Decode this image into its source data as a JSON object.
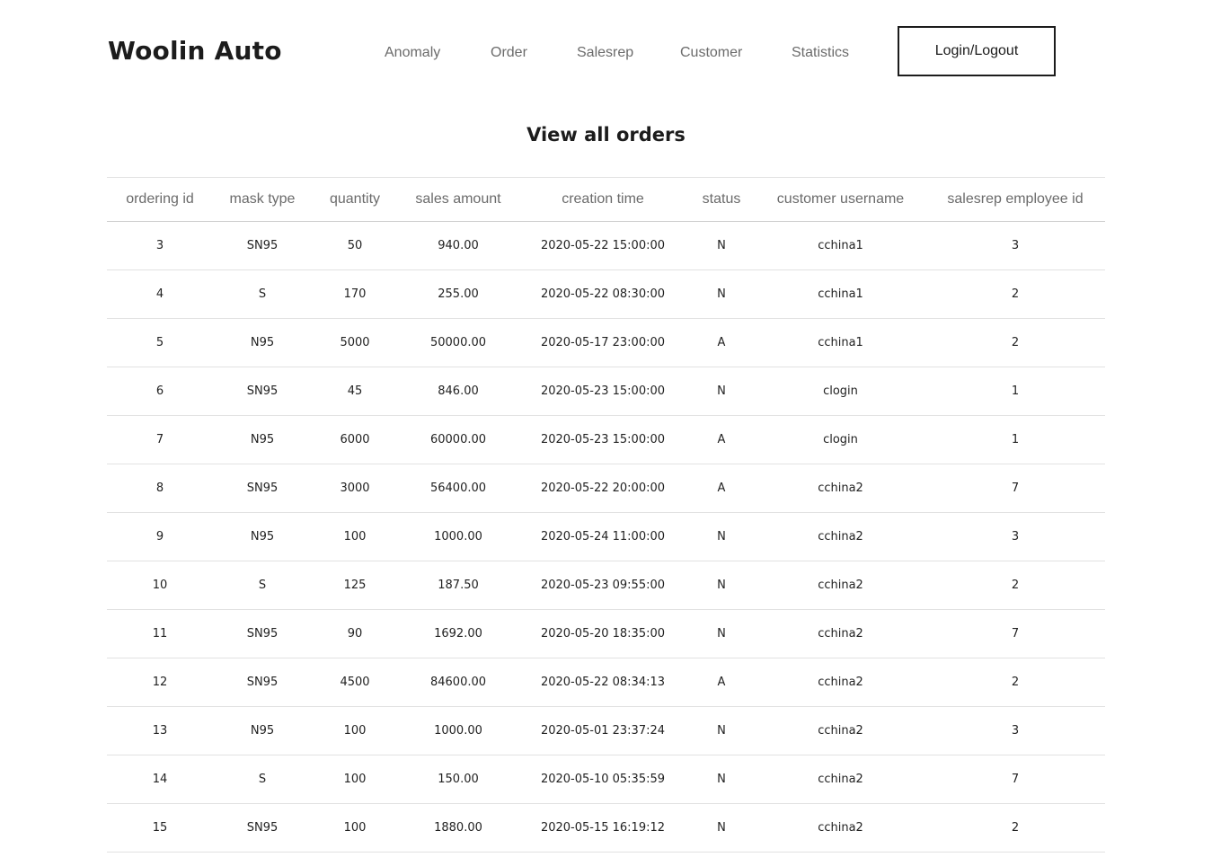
{
  "header": {
    "logo": "Woolin Auto",
    "nav": [
      {
        "label": "Anomaly"
      },
      {
        "label": "Order"
      },
      {
        "label": "Salesrep"
      },
      {
        "label": "Customer"
      },
      {
        "label": "Statistics"
      }
    ],
    "login_label": "Login/Logout"
  },
  "main": {
    "title": "View all orders",
    "columns": [
      "ordering id",
      "mask type",
      "quantity",
      "sales amount",
      "creation time",
      "status",
      "customer username",
      "salesrep employee id"
    ],
    "rows": [
      [
        "3",
        "SN95",
        "50",
        "940.00",
        "2020-05-22 15:00:00",
        "N",
        "cchina1",
        "3"
      ],
      [
        "4",
        "S",
        "170",
        "255.00",
        "2020-05-22 08:30:00",
        "N",
        "cchina1",
        "2"
      ],
      [
        "5",
        "N95",
        "5000",
        "50000.00",
        "2020-05-17 23:00:00",
        "A",
        "cchina1",
        "2"
      ],
      [
        "6",
        "SN95",
        "45",
        "846.00",
        "2020-05-23 15:00:00",
        "N",
        "clogin",
        "1"
      ],
      [
        "7",
        "N95",
        "6000",
        "60000.00",
        "2020-05-23 15:00:00",
        "A",
        "clogin",
        "1"
      ],
      [
        "8",
        "SN95",
        "3000",
        "56400.00",
        "2020-05-22 20:00:00",
        "A",
        "cchina2",
        "7"
      ],
      [
        "9",
        "N95",
        "100",
        "1000.00",
        "2020-05-24 11:00:00",
        "N",
        "cchina2",
        "3"
      ],
      [
        "10",
        "S",
        "125",
        "187.50",
        "2020-05-23 09:55:00",
        "N",
        "cchina2",
        "2"
      ],
      [
        "11",
        "SN95",
        "90",
        "1692.00",
        "2020-05-20 18:35:00",
        "N",
        "cchina2",
        "7"
      ],
      [
        "12",
        "SN95",
        "4500",
        "84600.00",
        "2020-05-22 08:34:13",
        "A",
        "cchina2",
        "2"
      ],
      [
        "13",
        "N95",
        "100",
        "1000.00",
        "2020-05-01 23:37:24",
        "N",
        "cchina2",
        "3"
      ],
      [
        "14",
        "S",
        "100",
        "150.00",
        "2020-05-10 05:35:59",
        "N",
        "cchina2",
        "7"
      ],
      [
        "15",
        "SN95",
        "100",
        "1880.00",
        "2020-05-15 16:19:12",
        "N",
        "cchina2",
        "2"
      ]
    ]
  }
}
